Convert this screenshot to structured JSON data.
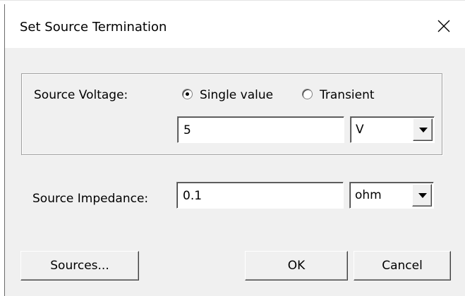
{
  "dialog": {
    "title": "Set Source Termination"
  },
  "voltage": {
    "label": "Source Voltage:",
    "options": [
      {
        "label": "Single value",
        "selected": true
      },
      {
        "label": "Transient",
        "selected": false
      }
    ],
    "value": "5",
    "unit": "V"
  },
  "impedance": {
    "label": "Source Impedance:",
    "value": "0.1",
    "unit": "ohm"
  },
  "buttons": {
    "sources": "Sources...",
    "ok": "OK",
    "cancel": "Cancel"
  },
  "icons": {
    "close": "close-icon",
    "dropdown": "chevron-down-icon"
  }
}
